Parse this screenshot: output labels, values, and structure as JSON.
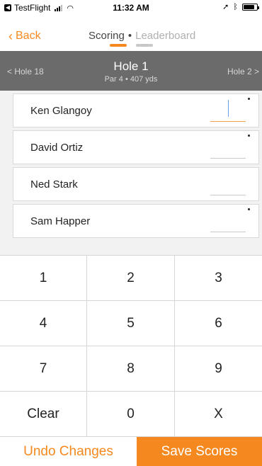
{
  "status_bar": {
    "app_name": "TestFlight",
    "time": "11:32 AM",
    "battery_level": 0.85
  },
  "nav": {
    "back_label": "Back",
    "segment_scoring": "Scoring",
    "segment_separator": "•",
    "segment_leaderboard": "Leaderboard"
  },
  "hole": {
    "prev_label": "< Hole 18",
    "next_label": "Hole 2 >",
    "title": "Hole 1",
    "subtitle": "Par 4 • 407 yds"
  },
  "players": [
    {
      "name": "Ken Glangoy",
      "score": "",
      "active": true,
      "marker": true
    },
    {
      "name": "David Ortiz",
      "score": "",
      "active": false,
      "marker": true
    },
    {
      "name": "Ned Stark",
      "score": "",
      "active": false,
      "marker": false
    },
    {
      "name": "Sam Happer",
      "score": "",
      "active": false,
      "marker": true
    }
  ],
  "keypad": {
    "keys": [
      "1",
      "2",
      "3",
      "4",
      "5",
      "6",
      "7",
      "8",
      "9",
      "Clear",
      "0",
      "X"
    ]
  },
  "actions": {
    "undo_label": "Undo Changes",
    "save_label": "Save Scores"
  },
  "colors": {
    "accent": "#f5891f",
    "header_bg": "#6b6b6b"
  }
}
